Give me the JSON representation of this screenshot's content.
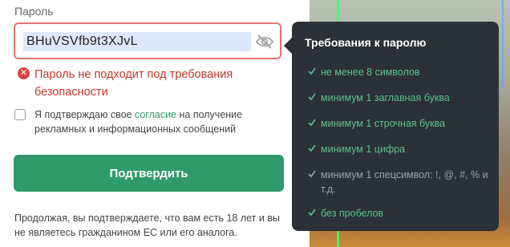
{
  "password": {
    "label": "Пароль",
    "value": "BHuVSVfb9t3XJvL",
    "toggle_icon": "eye-off-icon",
    "error": "Пароль не подходит под требования безопасности"
  },
  "consent": {
    "checked": false,
    "text_before": "Я подтверждаю свое ",
    "link": "согласие",
    "text_after": " на получение рекламных и информационных сообщений"
  },
  "submit_label": "Подтвердить",
  "disclaimer": "Продолжая, вы подтверждаете, что вам есть 18 лет и вы не являетесь гражданином ЕС или его аналога.",
  "requirements": {
    "title": "Требования к паролю",
    "items": [
      {
        "label": "не менее 8 символов",
        "met": true
      },
      {
        "label": "минимум 1 заглавная буква",
        "met": true
      },
      {
        "label": "минимум 1 строчная буква",
        "met": true
      },
      {
        "label": "минимум 1 цифра",
        "met": true
      },
      {
        "label": "минимум 1 спецсимвол: !, @, #, % и т.д.",
        "met": false
      },
      {
        "label": "без пробелов",
        "met": true
      }
    ]
  },
  "colors": {
    "accent": "#2f9a69",
    "error": "#d94444",
    "panel": "#2b3136",
    "met": "#5ec291",
    "unmet": "#9ca3a8"
  }
}
